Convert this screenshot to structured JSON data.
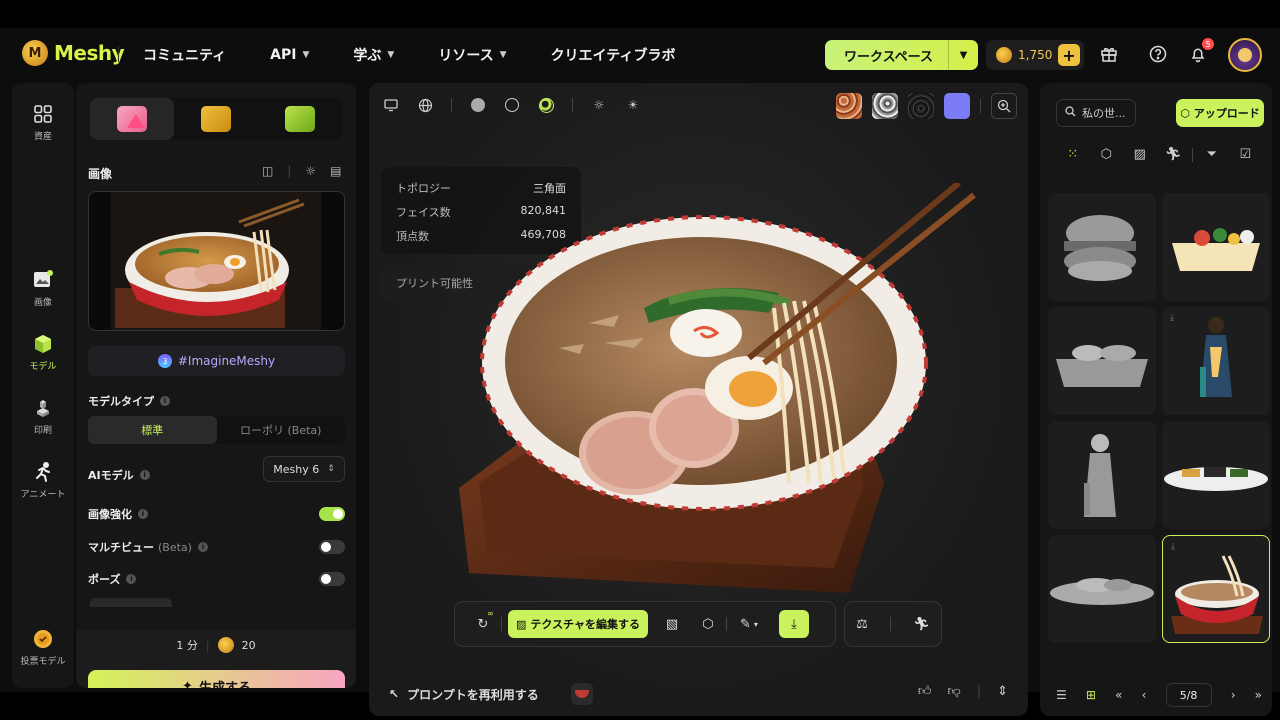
{
  "brand": {
    "name": "Meshy"
  },
  "nav": {
    "items": [
      {
        "label": "コミュニティ",
        "dropdown": false
      },
      {
        "label": "API",
        "dropdown": true
      },
      {
        "label": "学ぶ",
        "dropdown": true
      },
      {
        "label": "リソース",
        "dropdown": true
      },
      {
        "label": "クリエイティブラボ",
        "dropdown": false
      }
    ]
  },
  "header": {
    "workspace_label": "ワークスペース",
    "credits": "1,750",
    "notification_count": "5",
    "accent": "#c9f25c"
  },
  "rail": {
    "assets": "資産",
    "image": "画像",
    "model": "モデル",
    "print": "印刷",
    "animate": "アニメート",
    "vote": "投票モデル"
  },
  "panel": {
    "section_image": "画像",
    "tag": "#ImagineMeshy",
    "model_type_label": "モデルタイプ",
    "model_type_options": [
      "標準",
      "ローポリ (Beta)"
    ],
    "ai_model_label": "AIモデル",
    "ai_model_value": "Meshy 6",
    "enhance_label": "画像強化",
    "multiview_label": "マルチビュー",
    "multiview_beta": "(Beta)",
    "pose_label": "ポーズ",
    "time": "1 分",
    "cost": "20",
    "generate": "生成する"
  },
  "viewer": {
    "stats": [
      {
        "key": "トポロジー",
        "value": "三角面"
      },
      {
        "key": "フェイス数",
        "value": "820,841"
      },
      {
        "key": "頂点数",
        "value": "469,708"
      }
    ],
    "printable": "プリント可能性",
    "edit_texture": "テクスチャを編集する",
    "reuse_prompt": "プロンプトを再利用する",
    "infinity": "∞"
  },
  "library": {
    "search_placeholder": "私の世...",
    "upload": "アップロード",
    "page": "5/8"
  }
}
